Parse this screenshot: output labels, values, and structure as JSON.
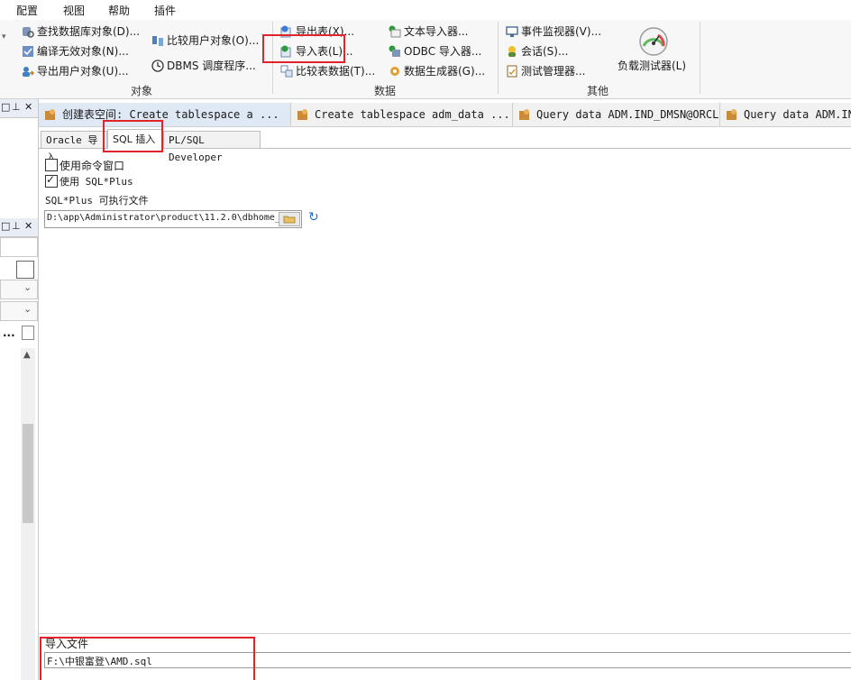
{
  "menu": [
    "配置",
    "视图",
    "帮助",
    "插件"
  ],
  "ribbon": {
    "objects": {
      "items": [
        "查找数据库对象(D)...",
        "编译无效对象(N)...",
        "导出用户对象(U)...",
        "比较用户对象(O)...",
        "DBMS 调度程序..."
      ],
      "label": "对象"
    },
    "data": {
      "items": [
        "导出表(X)...",
        "导入表(L)...",
        "比较表数据(T)...",
        "文本导入器...",
        "ODBC 导入器...",
        "数据生成器(G)..."
      ],
      "label": "数据"
    },
    "other": {
      "items": [
        "事件监视器(V)...",
        "会话(S)...",
        "测试管理器...",
        "负载测试器(L)"
      ],
      "label": "其他"
    }
  },
  "left_panel": {
    "ellipsis": "..."
  },
  "doc_tabs": [
    "创建表空间: Create tablespace a ...",
    "Create tablespace adm_data ...",
    "Query data ADM.IND_DMSN@ORCL",
    "Query data ADM.IN"
  ],
  "sub_tabs": [
    "Oracle 导入",
    "SQL 插入",
    "PL/SQL Developer"
  ],
  "options": {
    "use_cmd_window": "使用命令窗口",
    "use_cmd_checked": false,
    "use_sqlplus": "使用 SQL*Plus",
    "use_sqlplus_checked": true,
    "sqlplus_exe_label": "SQL*Plus 可执行文件",
    "sqlplus_exe_value": "D:\\app\\Administrator\\product\\11.2.0\\dbhome_"
  },
  "import_file": {
    "label": "导入文件",
    "value": "F:\\中银富登\\AMD.sql"
  }
}
